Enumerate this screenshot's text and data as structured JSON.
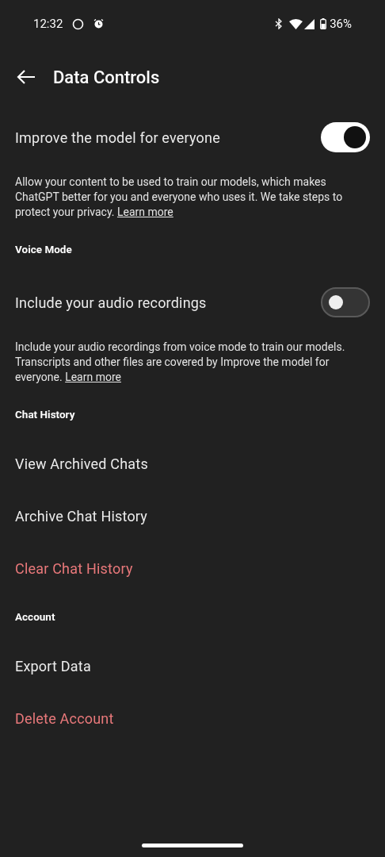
{
  "status_bar": {
    "time": "12:32",
    "battery": "36%"
  },
  "header": {
    "title": "Data Controls"
  },
  "items": [
    {
      "kind": "toggle",
      "label": "Improve the model for everyone",
      "on": true
    },
    {
      "kind": "note",
      "text": "Allow your content to be used to train our models, which makes ChatGPT better for you and everyone who uses it. We take steps to protect your privacy.",
      "link": "Learn more"
    },
    {
      "kind": "heading",
      "label": "Voice Mode"
    },
    {
      "kind": "toggle",
      "label": "Include your audio recordings",
      "on": false
    },
    {
      "kind": "note",
      "text": "Include your audio recordings from voice mode to train our models. Transcripts and other files are covered by Improve the model for everyone.",
      "link": "Learn more"
    },
    {
      "kind": "heading",
      "label": "Chat History"
    },
    {
      "kind": "action",
      "label": "View Archived Chats",
      "destructive": false
    },
    {
      "kind": "action",
      "label": "Archive Chat History",
      "destructive": false
    },
    {
      "kind": "action",
      "label": "Clear Chat History",
      "destructive": true
    },
    {
      "kind": "heading",
      "label": "Account"
    },
    {
      "kind": "action",
      "label": "Export Data",
      "destructive": false
    },
    {
      "kind": "action",
      "label": "Delete Account",
      "destructive": true
    }
  ]
}
